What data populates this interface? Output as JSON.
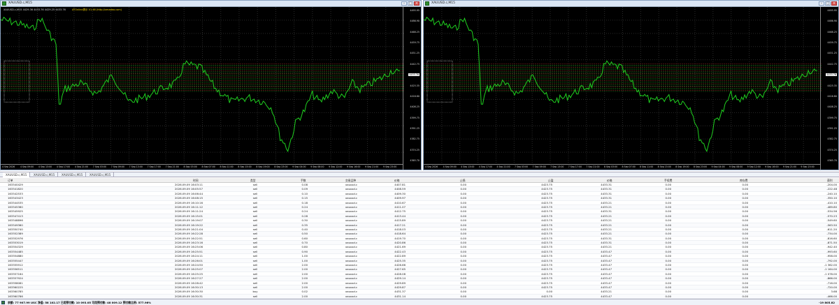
{
  "charts": [
    {
      "window_title": "XAUUSD.c,M15",
      "info_line": "XAUUSD.c,M15  4429.36 4433.76 4429.25 4433.76",
      "ea_label": "ATOnline提示 V1.46 (http://xmadea.com)",
      "price_labels": [
        "4495.95",
        "4486.90",
        "4468.25",
        "4459.75",
        "4451.25",
        "4442.75",
        "4433.76",
        "4425.35",
        "4416.80",
        "4408.25",
        "4399.75",
        "4391.25",
        "4382.75",
        "4374.25",
        "4365.70"
      ],
      "current_price": "4433.76",
      "time_labels": [
        "4 Sep 2026",
        "4 Sep 09:00",
        "4 Sep 13:00",
        "4 Sep 17:00",
        "4 Sep 21:00",
        "7 Sep 03:00",
        "7 Sep 09:00",
        "7 Sep 13:00",
        "7 Sep 17:00",
        "7 Sep 21:00",
        "8 Sep 03:00",
        "8 Sep 07:00",
        "8 Sep 11:00",
        "8 Sep 15:00",
        "8 Sep 19:00",
        "8 Sep 23:00",
        "9 Sep 04:00",
        "9 Sep 08:00",
        "9 Sep 12:00",
        "9 Sep 16:00",
        "9 Sep 21:00",
        "9 Sep 23:00"
      ],
      "line_color": "#1fcf1f"
    },
    {
      "window_title": "XAUUSD.c,M15",
      "info_line": "",
      "ea_label": "",
      "price_labels": [
        "4495.95",
        "4486.90",
        "4468.25",
        "4459.75",
        "4451.25",
        "4442.75",
        "4433.76",
        "4425.35",
        "4416.80",
        "4408.25",
        "4399.75",
        "4391.25",
        "4382.75",
        "4374.25",
        "4365.70"
      ],
      "current_price": "4433.76",
      "time_labels": [
        "4 Sep 2026",
        "4 Sep 09:00",
        "4 Sep 13:00",
        "4 Sep 17:00",
        "4 Sep 21:00",
        "7 Sep 03:00",
        "7 Sep 09:00",
        "7 Sep 13:00",
        "7 Sep 17:00",
        "7 Sep 21:00",
        "8 Sep 03:00",
        "8 Sep 07:00",
        "8 Sep 11:00",
        "8 Sep 15:00",
        "8 Sep 19:00",
        "8 Sep 23:00",
        "9 Sep 04:00",
        "9 Sep 08:00",
        "9 Sep 12:00",
        "9 Sep 16:00",
        "9 Sep 21:00",
        "9 Sep 23:00"
      ],
      "line_color": "#1fcf1f"
    }
  ],
  "tabs": [
    "XAUUSD.c,M15",
    "XAUUSD.c,M15",
    "XAUUSD.c,M15",
    "XAUUSD.c,M15"
  ],
  "table": {
    "headers": {
      "ticket": "订单",
      "time": "时间",
      "type": "类型",
      "volume": "手数",
      "symbol": "交易品种",
      "price": "价格",
      "sl": "止损",
      "tp": "止盈",
      "cur_price": "价格",
      "commission": "手续费",
      "swap": "库存费",
      "profit": "获利"
    },
    "rows": [
      [
        "163340429",
        "2026.09.09 16:03:11",
        "sell",
        "0.08",
        "xauusd.c",
        "4407.81",
        "0.00",
        "4423.75",
        "4433.31",
        "0.00",
        "0.00",
        "-204.00"
      ],
      [
        "163341820",
        "2026.09.09 16:05:57",
        "sell",
        "0.09",
        "xauusd.c",
        "4408.59",
        "0.00",
        "4423.75",
        "4433.31",
        "0.00",
        "0.00",
        "-222.48"
      ],
      [
        "163342533",
        "2026.09.09 16:06:44",
        "sell",
        "0.10",
        "xauusd.c",
        "4409.30",
        "0.00",
        "4423.75",
        "4433.31",
        "0.00",
        "0.00",
        "-240.10"
      ],
      [
        "163343423",
        "2026.09.09 16:08:15",
        "sell",
        "0.15",
        "xauusd.c",
        "4409.97",
        "0.00",
        "4423.75",
        "4433.31",
        "0.00",
        "0.00",
        "-350.10"
      ],
      [
        "163344535",
        "2026.09.09 16:10:16",
        "sell",
        "0.18",
        "xauusd.c",
        "4410.67",
        "0.00",
        "4423.75",
        "4433.21",
        "0.00",
        "0.00",
        "-410.10"
      ],
      [
        "163345360",
        "2026.09.09 16:11:12",
        "sell",
        "0.24",
        "xauusd.c",
        "4411.07",
        "0.00",
        "4423.75",
        "4433.21",
        "0.00",
        "0.00",
        "-489.80"
      ],
      [
        "163345925",
        "2026.09.09 16:11:24",
        "sell",
        "0.24",
        "xauusd.c",
        "4412.75",
        "0.00",
        "4423.75",
        "4433.31",
        "0.00",
        "0.00",
        "-534.56"
      ],
      [
        "163347413",
        "2026.09.09 16:15:01",
        "sell",
        "0.28",
        "xauusd.c",
        "4413.44",
        "0.00",
        "4423.75",
        "4433.21",
        "0.00",
        "0.00",
        "-570.23"
      ],
      [
        "163348896",
        "2026.09.09 16:19:07",
        "sell",
        "0.30",
        "xauusd.c",
        "4415.89",
        "0.00",
        "4423.75",
        "4433.21",
        "0.00",
        "0.00",
        "-549.60"
      ],
      [
        "163349360",
        "2026.09.09 16:19:22",
        "sell",
        "0.35",
        "xauusd.c",
        "4417.21",
        "0.00",
        "4423.75",
        "4433.21",
        "0.00",
        "0.00",
        "-563.50"
      ],
      [
        "163350740",
        "2026.09.09 16:21:04",
        "sell",
        "0.40",
        "xauusd.c",
        "4418.03",
        "0.00",
        "4423.75",
        "4433.21",
        "0.00",
        "0.00",
        "-611.20"
      ],
      [
        "163352389",
        "2026.09.09 16:22:28",
        "sell",
        "0.50",
        "xauusd.c",
        "4418.64",
        "0.00",
        "4423.75",
        "4433.21",
        "0.00",
        "0.00",
        "-734.00"
      ],
      [
        "163352976",
        "2026.09.09 16:22:51",
        "sell",
        "0.60",
        "xauusd.c",
        "4419.70",
        "0.00",
        "4423.75",
        "4433.31",
        "0.00",
        "0.00",
        "-816.60"
      ],
      [
        "163353019",
        "2026.09.09 16:23:16",
        "sell",
        "0.70",
        "xauusd.c",
        "4420.86",
        "0.00",
        "4423.75",
        "4433.31",
        "0.00",
        "0.00",
        "-871.50"
      ],
      [
        "163354329",
        "2026.09.09 16:25:06",
        "sell",
        "0.80",
        "xauusd.c",
        "4421.69",
        "0.00",
        "4423.75",
        "4433.21",
        "0.00",
        "0.00",
        "-942.40"
      ],
      [
        "163354485",
        "2026.09.09 16:25:51",
        "sell",
        "0.90",
        "xauusd.c",
        "4422.43",
        "0.00",
        "4423.75",
        "4433.47",
        "0.00",
        "0.00",
        "-993.60"
      ],
      [
        "163354880",
        "2026.09.09 16:24:11",
        "sell",
        "1.00",
        "xauusd.c",
        "4422.89",
        "0.00",
        "4423.75",
        "4433.47",
        "0.00",
        "0.00",
        "-958.00"
      ],
      [
        "163355447",
        "2026.09.09 16:26:01",
        "sell",
        "1.00",
        "xauusd.c",
        "4425.35",
        "0.00",
        "4423.75",
        "4433.47",
        "0.00",
        "0.00",
        "-792.00"
      ],
      [
        "163355912",
        "2026.09.09 16:24:50",
        "sell",
        "2.00",
        "xauusd.c",
        "4426.66",
        "0.00",
        "4423.75",
        "4433.47",
        "0.00",
        "0.00",
        "-1 362.00"
      ],
      [
        "163356511",
        "2026.09.09 16:25:07",
        "sell",
        "2.00",
        "xauusd.c",
        "4427.65",
        "0.00",
        "4423.75",
        "4433.47",
        "0.00",
        "0.00",
        "-1 164.00"
      ],
      [
        "163357164",
        "2026.09.09 16:25:25",
        "sell",
        "2.00",
        "xauusd.c",
        "4428.08",
        "0.00",
        "4423.75",
        "4433.47",
        "0.00",
        "0.00",
        "-1 078.00"
      ],
      [
        "163357924",
        "2026.09.09 16:27:27",
        "sell",
        "2.00",
        "xauusd.c",
        "4429.14",
        "0.00",
        "4423.75",
        "4433.47",
        "0.00",
        "0.00",
        "-866.00"
      ],
      [
        "163358081",
        "2026.09.09 16:28:42",
        "sell",
        "2.00",
        "xauusd.c",
        "4429.89",
        "0.00",
        "4423.75",
        "4433.47",
        "0.00",
        "0.00",
        "-716.00"
      ],
      [
        "163360225",
        "2026.09.09 16:30:13",
        "sell",
        "2.00",
        "xauusd.c",
        "4429.87",
        "0.00",
        "4423.75",
        "4433.47",
        "0.00",
        "0.00",
        "-720.00"
      ],
      [
        "163360785",
        "2026.09.09 16:30:30",
        "buy",
        "0.02",
        "xauusd.c",
        "4431.37",
        "0.00",
        "0.00",
        "4433.21",
        "0.00",
        "0.00",
        "3.68"
      ],
      [
        "163360786",
        "2026.09.09 16:30:31",
        "sell",
        "2.00",
        "xauusd.c",
        "4431.14",
        "0.00",
        "4423.75",
        "4433.47",
        "0.00",
        "0.00",
        "-466.00"
      ]
    ]
  },
  "status": {
    "text": "余额: 77 907.99 USC  净值: 58 102.17  已用预付款: 10 093.05  可用预付款: 48 009.12  预付款比例: 577.96%",
    "total_profit": "-19 805.82"
  },
  "colors": {
    "sell_icon": "#c0392b",
    "buy_icon": "#2a6fd1",
    "chart_bg": "#000000",
    "chart_line": "#1fcf1f"
  }
}
